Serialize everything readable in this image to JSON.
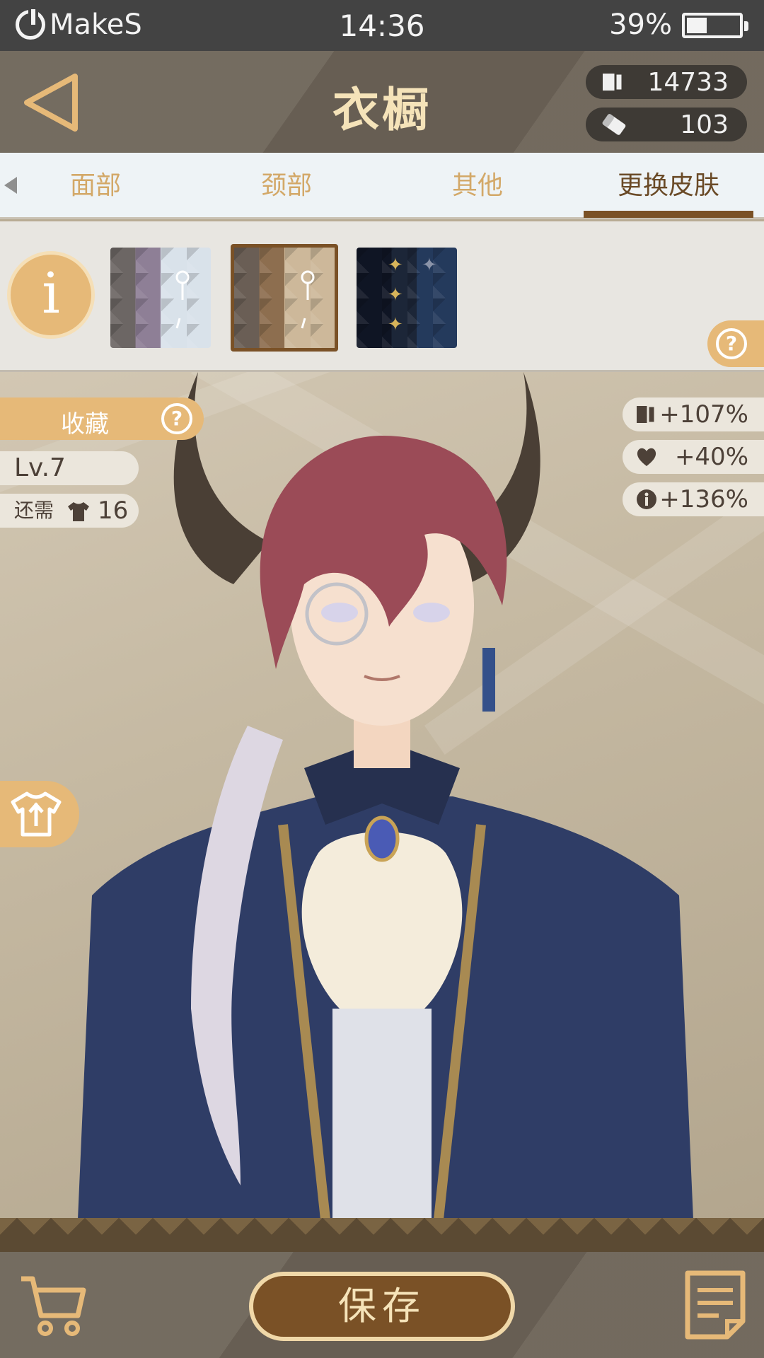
{
  "status_bar": {
    "brand": "MakeS",
    "time": "14:36",
    "battery": "39%",
    "battery_level": 0.39
  },
  "header": {
    "title": "衣橱",
    "back_icon": "back-triangle-icon",
    "currency_1": {
      "icon": "ticket-icon",
      "value": "14733"
    },
    "currency_2": {
      "icon": "eraser-icon",
      "value": "103"
    }
  },
  "tabs": {
    "items": [
      {
        "label": "面部"
      },
      {
        "label": "颈部"
      },
      {
        "label": "其他"
      },
      {
        "label": "更换皮肤",
        "active": true
      }
    ]
  },
  "skins": {
    "info_symbol": "i",
    "help_symbol": "?",
    "items": [
      {
        "name": "gray-purple",
        "selected": false
      },
      {
        "name": "brown-beige",
        "selected": true
      },
      {
        "name": "navy-star",
        "selected": false
      }
    ]
  },
  "character": {
    "favorite_label": "收藏",
    "favorite_help": "?",
    "level": "Lv.7",
    "needs_label": "还需",
    "needs_value": "16"
  },
  "bonuses": [
    {
      "icon": "ticket-icon",
      "value": "+107%"
    },
    {
      "icon": "heart-icon",
      "value": "+40%"
    },
    {
      "icon": "info-icon",
      "value": "+136%"
    }
  ],
  "bottom_bar": {
    "save_label": "保存",
    "cart_icon": "cart-icon",
    "notes_icon": "notes-icon"
  },
  "colors": {
    "accent": "#e6b978",
    "brown": "#7a5126",
    "title": "#f5e3b9",
    "header_bg": "#6d6458"
  }
}
